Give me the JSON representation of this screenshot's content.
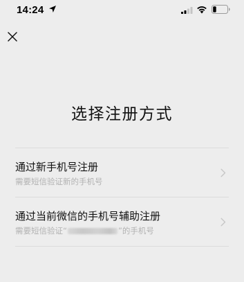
{
  "status_bar": {
    "time": "14:24",
    "location_icon": "location-arrow-icon",
    "signal_icon": "cellular-signal-icon",
    "wifi_icon": "wifi-icon",
    "battery_icon": "battery-low-icon"
  },
  "header": {
    "close_icon": "close-icon"
  },
  "title": "选择注册方式",
  "options": [
    {
      "title": "通过新手机号注册",
      "subtitle": "需要短信验证新的手机号"
    },
    {
      "title": "通过当前微信的手机号辅助注册",
      "subtitle_prefix": "需要短信验证“",
      "subtitle_suffix": "”的手机号"
    }
  ],
  "colors": {
    "background": "#ededed",
    "text_primary": "#111111",
    "text_secondary": "#b2b2b2",
    "divider": "#dcdcdc",
    "chevron": "#c7c7c7"
  }
}
